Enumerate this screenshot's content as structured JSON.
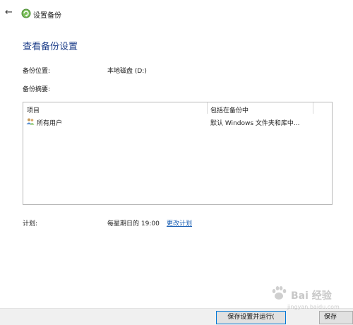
{
  "window": {
    "title": "设置备份",
    "back_icon": "back-arrow-icon",
    "title_icon": "backup-icon"
  },
  "main": {
    "heading": "查看备份设置",
    "location_label": "备份位置:",
    "location_value": "本地磁盘 (D:)",
    "summary_label": "备份摘要:",
    "table": {
      "columns": [
        "项目",
        "包括在备份中"
      ],
      "rows": [
        {
          "icon": "users-icon",
          "item": "所有用户",
          "included": "默认 Windows 文件夹和库中..."
        }
      ]
    },
    "schedule_label": "计划:",
    "schedule_value": "每星期日的 19:00",
    "change_schedule_link": "更改计划"
  },
  "footer": {
    "save_run_button": "保存设置并运行(",
    "cancel_button": "保存"
  },
  "watermark": {
    "text": "Bai 经验",
    "url_text": "jingyan.baidu.com"
  },
  "colors": {
    "heading": "#1e3f8a",
    "link": "#1a5fb4",
    "primary_border": "#0078d7"
  }
}
